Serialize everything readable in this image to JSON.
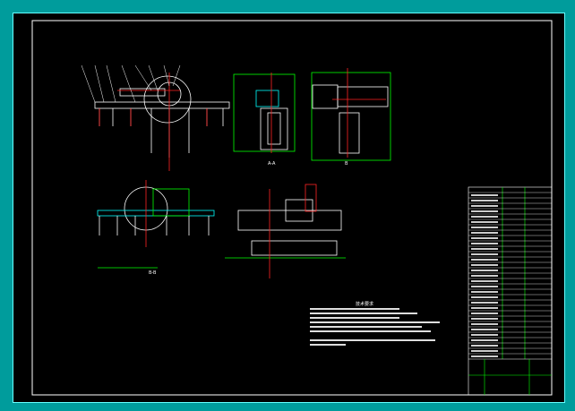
{
  "drawing": {
    "notes_heading": "技术要求",
    "view_labels": [
      "A-A",
      "B",
      "B-B"
    ],
    "colors": {
      "background": "#000000",
      "frame": "#ffffff",
      "outline": "#ffffff",
      "center": "#ff2020",
      "dimension": "#00ff00",
      "section": "#00ffff"
    }
  }
}
